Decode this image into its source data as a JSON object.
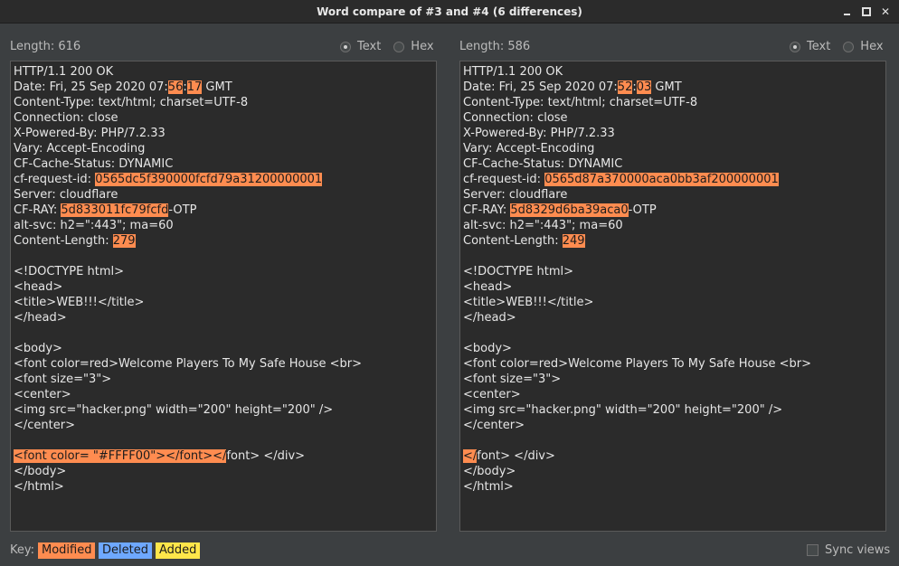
{
  "window": {
    "title": "Word compare of #3 and #4 (6 differences)",
    "controls": {
      "minimize": "minimize-icon",
      "maximize": "maximize-icon",
      "close": "close-icon"
    }
  },
  "left_pane": {
    "length_label": "Length: 616",
    "mode_options": [
      {
        "label": "Text",
        "selected": true
      },
      {
        "label": "Hex",
        "selected": false
      }
    ],
    "lines": [
      [
        {
          "t": "HTTP/1.1 200 OK",
          "m": false
        }
      ],
      [
        {
          "t": "Date: Fri, 25 Sep 2020 07:",
          "m": false
        },
        {
          "t": "56",
          "m": true
        },
        {
          "t": ":",
          "m": false
        },
        {
          "t": "17",
          "m": true
        },
        {
          "t": " GMT",
          "m": false
        }
      ],
      [
        {
          "t": "Content-Type: text/html; charset=UTF-8",
          "m": false
        }
      ],
      [
        {
          "t": "Connection: close",
          "m": false
        }
      ],
      [
        {
          "t": "X-Powered-By: PHP/7.2.33",
          "m": false
        }
      ],
      [
        {
          "t": "Vary: Accept-Encoding",
          "m": false
        }
      ],
      [
        {
          "t": "CF-Cache-Status: DYNAMIC",
          "m": false
        }
      ],
      [
        {
          "t": "cf-request-id: ",
          "m": false
        },
        {
          "t": "0565dc5f390000fcfd79a31200000001",
          "m": true
        }
      ],
      [
        {
          "t": "Server: cloudflare",
          "m": false
        }
      ],
      [
        {
          "t": "CF-RAY: ",
          "m": false
        },
        {
          "t": "5d833011fc79fcfd",
          "m": true
        },
        {
          "t": "-OTP",
          "m": false
        }
      ],
      [
        {
          "t": "alt-svc: h2=\":443\"; ma=60",
          "m": false
        }
      ],
      [
        {
          "t": "Content-Length: ",
          "m": false
        },
        {
          "t": "279",
          "m": true
        }
      ],
      [
        {
          "t": "",
          "m": false
        }
      ],
      [
        {
          "t": "<!DOCTYPE html>",
          "m": false
        }
      ],
      [
        {
          "t": "<head>",
          "m": false
        }
      ],
      [
        {
          "t": "<title>WEB!!!</title>",
          "m": false
        }
      ],
      [
        {
          "t": "</head>",
          "m": false
        }
      ],
      [
        {
          "t": "",
          "m": false
        }
      ],
      [
        {
          "t": "<body>",
          "m": false
        }
      ],
      [
        {
          "t": "<font color=red>Welcome Players To My Safe House <br>",
          "m": false
        }
      ],
      [
        {
          "t": "<font size=\"3\">",
          "m": false
        }
      ],
      [
        {
          "t": "<center>",
          "m": false
        }
      ],
      [
        {
          "t": "<img src=\"hacker.png\" width=\"200\" height=\"200\" />",
          "m": false
        }
      ],
      [
        {
          "t": "</center>",
          "m": false
        }
      ],
      [
        {
          "t": "",
          "m": false
        }
      ],
      [
        {
          "t": "<font color= \"#FFFF00\"></font></",
          "m": true
        },
        {
          "t": "font> </div>",
          "m": false
        }
      ],
      [
        {
          "t": "</body>",
          "m": false
        }
      ],
      [
        {
          "t": "</html>",
          "m": false
        }
      ]
    ]
  },
  "right_pane": {
    "length_label": "Length: 586",
    "mode_options": [
      {
        "label": "Text",
        "selected": true
      },
      {
        "label": "Hex",
        "selected": false
      }
    ],
    "lines": [
      [
        {
          "t": "HTTP/1.1 200 OK",
          "m": false
        }
      ],
      [
        {
          "t": "Date: Fri, 25 Sep 2020 07:",
          "m": false
        },
        {
          "t": "52",
          "m": true
        },
        {
          "t": ":",
          "m": false
        },
        {
          "t": "03",
          "m": true
        },
        {
          "t": " GMT",
          "m": false
        }
      ],
      [
        {
          "t": "Content-Type: text/html; charset=UTF-8",
          "m": false
        }
      ],
      [
        {
          "t": "Connection: close",
          "m": false
        }
      ],
      [
        {
          "t": "X-Powered-By: PHP/7.2.33",
          "m": false
        }
      ],
      [
        {
          "t": "Vary: Accept-Encoding",
          "m": false
        }
      ],
      [
        {
          "t": "CF-Cache-Status: DYNAMIC",
          "m": false
        }
      ],
      [
        {
          "t": "cf-request-id: ",
          "m": false
        },
        {
          "t": "0565d87a370000aca0bb3af200000001",
          "m": true
        }
      ],
      [
        {
          "t": "Server: cloudflare",
          "m": false
        }
      ],
      [
        {
          "t": "CF-RAY: ",
          "m": false
        },
        {
          "t": "5d8329d6ba39aca0",
          "m": true
        },
        {
          "t": "-OTP",
          "m": false
        }
      ],
      [
        {
          "t": "alt-svc: h2=\":443\"; ma=60",
          "m": false
        }
      ],
      [
        {
          "t": "Content-Length: ",
          "m": false
        },
        {
          "t": "249",
          "m": true
        }
      ],
      [
        {
          "t": "",
          "m": false
        }
      ],
      [
        {
          "t": "<!DOCTYPE html>",
          "m": false
        }
      ],
      [
        {
          "t": "<head>",
          "m": false
        }
      ],
      [
        {
          "t": "<title>WEB!!!</title>",
          "m": false
        }
      ],
      [
        {
          "t": "</head>",
          "m": false
        }
      ],
      [
        {
          "t": "",
          "m": false
        }
      ],
      [
        {
          "t": "<body>",
          "m": false
        }
      ],
      [
        {
          "t": "<font color=red>Welcome Players To My Safe House <br>",
          "m": false
        }
      ],
      [
        {
          "t": "<font size=\"3\">",
          "m": false
        }
      ],
      [
        {
          "t": "<center>",
          "m": false
        }
      ],
      [
        {
          "t": "<img src=\"hacker.png\" width=\"200\" height=\"200\" />",
          "m": false
        }
      ],
      [
        {
          "t": "</center>",
          "m": false
        }
      ],
      [
        {
          "t": "",
          "m": false
        }
      ],
      [
        {
          "t": "</",
          "m": true
        },
        {
          "t": "font> </div>",
          "m": false
        }
      ],
      [
        {
          "t": "</body>",
          "m": false
        }
      ],
      [
        {
          "t": "</html>",
          "m": false
        }
      ]
    ]
  },
  "footer": {
    "key_label": "Key:",
    "keys": {
      "modified": "Modified",
      "deleted": "Deleted",
      "added": "Added"
    },
    "sync_views_label": "Sync views",
    "sync_views_checked": false
  },
  "colors": {
    "modified": "#ff8c50",
    "deleted": "#6ea8ff",
    "added": "#ffe64a"
  }
}
